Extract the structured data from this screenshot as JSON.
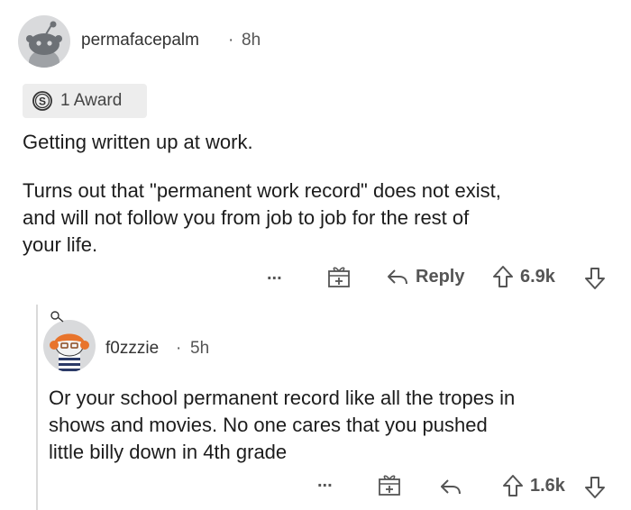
{
  "post": {
    "username": "permafacepalm",
    "separator": "·",
    "time": "8h",
    "award_label": "1 Award",
    "title": "Getting written up at work.",
    "body": "Turns out that \"permanent work record\" does not exist,\nand will not follow you from job to job for the rest of\nyour life.",
    "more": "...",
    "reply_label": "Reply",
    "score": "6.9k"
  },
  "reply": {
    "username": "f0zzzie",
    "separator": "·",
    "time": "5h",
    "body": "Or your school permanent record like all the tropes in\nshows and movies. No one cares that you pushed\nlittle billy down in 4th grade",
    "more": "...",
    "score": "1.6k"
  }
}
